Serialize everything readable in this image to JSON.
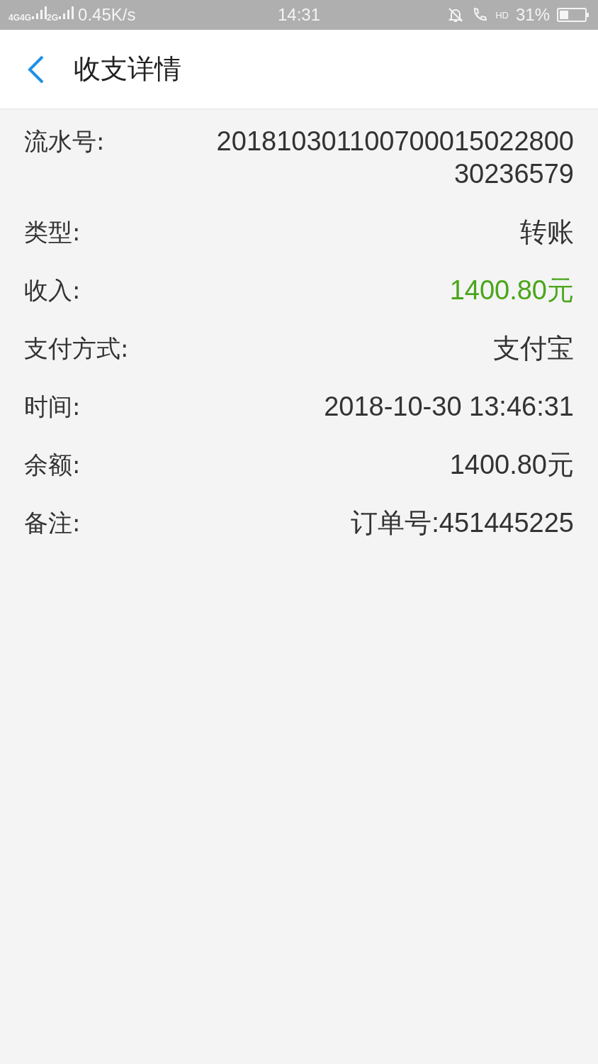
{
  "status_bar": {
    "network_labels": [
      "4G",
      "4G",
      "2G"
    ],
    "speed": "0.45K/s",
    "time": "14:31",
    "call_label": "HD",
    "battery": "31%"
  },
  "header": {
    "title": "收支详情"
  },
  "details": [
    {
      "label": "流水号:",
      "value": "20181030110070001502280030236579",
      "kind": "plain"
    },
    {
      "label": "类型:",
      "value": "转账",
      "kind": "plain"
    },
    {
      "label": "收入:",
      "value": "1400.80元",
      "kind": "income"
    },
    {
      "label": "支付方式:",
      "value": "支付宝",
      "kind": "plain"
    },
    {
      "label": "时间:",
      "value": "2018-10-30 13:46:31",
      "kind": "plain"
    },
    {
      "label": "余额:",
      "value": "1400.80元",
      "kind": "plain"
    },
    {
      "label": "备注:",
      "value": "订单号:451445225",
      "kind": "plain"
    }
  ]
}
